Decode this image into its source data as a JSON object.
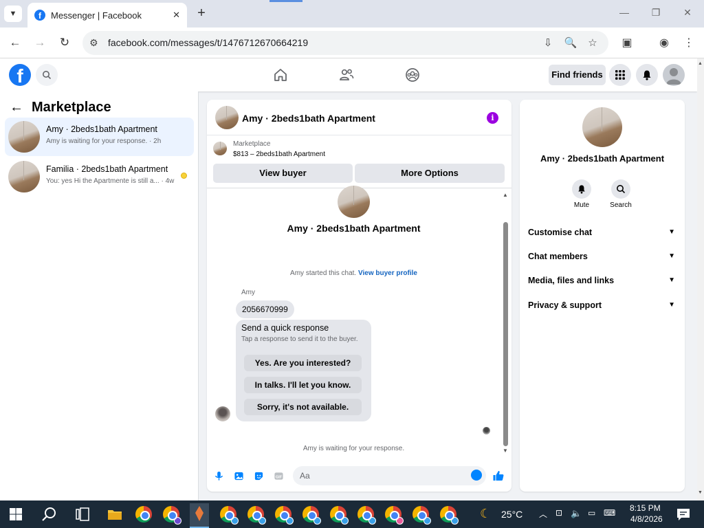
{
  "browser": {
    "tab_title": "Messenger | Facebook",
    "tab_close": "✕",
    "new_tab": "+",
    "url": "facebook.com/messages/t/1476712670664219"
  },
  "fb": {
    "logo": "f",
    "find_friends": "Find friends"
  },
  "sidebar": {
    "title": "Marketplace",
    "conversations": [
      {
        "name": "Amy · 2beds1bath Apartment",
        "snippet": "Amy is waiting for your response. · 2h"
      },
      {
        "name": "Familia · 2beds1bath Apartment",
        "snippet": "You: yes Hi the Apartmente is still a... · 4w"
      }
    ]
  },
  "chat": {
    "header_name": "Amy · 2beds1bath Apartment",
    "info_icon": "i",
    "marketplace_label": "Marketplace",
    "listing": "$813 – 2beds1bath Apartment",
    "view_buyer": "View buyer",
    "more_options": "More Options",
    "thread_name": "Amy · 2beds1bath Apartment",
    "started_text": "Amy started this chat.",
    "view_buyer_profile": "View buyer profile",
    "sender": "Amy",
    "message": "2056670999",
    "quick_title": "Send a quick response",
    "quick_sub": "Tap a response to send it to the buyer.",
    "quick_replies": [
      "Yes. Are you interested?",
      "In talks. I'll let you know.",
      "Sorry, it's not available."
    ],
    "waiting": "Amy is waiting for your response.",
    "composer_placeholder": "Aa"
  },
  "info_panel": {
    "name": "Amy · 2beds1bath Apartment",
    "mute": "Mute",
    "search": "Search",
    "sections": [
      "Customise chat",
      "Chat members",
      "Media, files and links",
      "Privacy & support"
    ]
  },
  "taskbar": {
    "temperature": "25°C",
    "time": "8:15 PM",
    "date": "4/8/2026"
  },
  "colors": {
    "facebook_blue": "#1877f2",
    "messenger_blue": "#0084ff",
    "link_blue": "#1565c0",
    "info_purple": "#9b00e0",
    "active_row": "#ebf3ff"
  }
}
